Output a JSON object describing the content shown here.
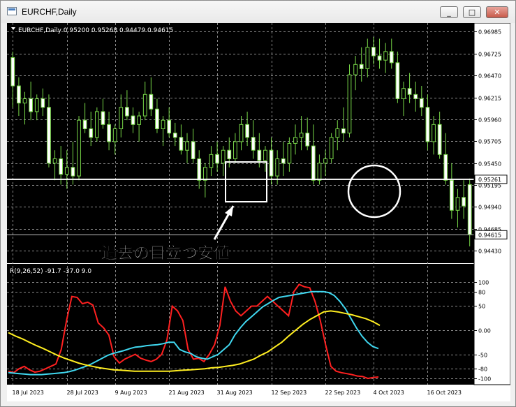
{
  "window": {
    "title": "EURCHF,Daily",
    "buttons": {
      "minimize": "_",
      "maximize": "□",
      "close": "✕"
    }
  },
  "chart_data": {
    "type": "candlestick",
    "symbol_info": "EURCHF,Daily  0.95200 0.95268 0.94479 0.94615",
    "price_axis": {
      "ylim": [
        0.943,
        0.9705
      ],
      "ticks": [
        "0.96985",
        "0.96725",
        "0.96470",
        "0.96215",
        "0.95960",
        "0.95705",
        "0.95450",
        "0.95195",
        "0.94940",
        "0.94685",
        "0.94430"
      ],
      "current_price_label": "0.94615",
      "horizontal_line_label": "0.95261"
    },
    "horizontal_line": 0.95261,
    "current_price": 0.94615,
    "date_axis": [
      "18 Jul 2023",
      "28 Jul 2023",
      "9 Aug 2023",
      "21 Aug 2023",
      "31 Aug 2023",
      "12 Sep 2023",
      "22 Sep 2023",
      "4 Oct 2023",
      "16 Oct 2023"
    ],
    "candles": [
      {
        "o": 0.9668,
        "h": 0.9675,
        "l": 0.961,
        "c": 0.9635
      },
      {
        "o": 0.9635,
        "h": 0.9645,
        "l": 0.96,
        "c": 0.9615
      },
      {
        "o": 0.9615,
        "h": 0.9628,
        "l": 0.959,
        "c": 0.962
      },
      {
        "o": 0.962,
        "h": 0.964,
        "l": 0.9595,
        "c": 0.9605
      },
      {
        "o": 0.9605,
        "h": 0.9625,
        "l": 0.9595,
        "c": 0.962
      },
      {
        "o": 0.962,
        "h": 0.9632,
        "l": 0.96,
        "c": 0.961
      },
      {
        "o": 0.961,
        "h": 0.9625,
        "l": 0.954,
        "c": 0.9545
      },
      {
        "o": 0.9545,
        "h": 0.956,
        "l": 0.9525,
        "c": 0.955
      },
      {
        "o": 0.955,
        "h": 0.9565,
        "l": 0.952,
        "c": 0.9532
      },
      {
        "o": 0.9532,
        "h": 0.956,
        "l": 0.9515,
        "c": 0.954
      },
      {
        "o": 0.954,
        "h": 0.957,
        "l": 0.952,
        "c": 0.953
      },
      {
        "o": 0.953,
        "h": 0.96,
        "l": 0.9525,
        "c": 0.9595
      },
      {
        "o": 0.9595,
        "h": 0.9615,
        "l": 0.958,
        "c": 0.9585
      },
      {
        "o": 0.9585,
        "h": 0.9605,
        "l": 0.9565,
        "c": 0.9575
      },
      {
        "o": 0.9575,
        "h": 0.961,
        "l": 0.957,
        "c": 0.9605
      },
      {
        "o": 0.9605,
        "h": 0.962,
        "l": 0.9585,
        "c": 0.959
      },
      {
        "o": 0.959,
        "h": 0.9605,
        "l": 0.956,
        "c": 0.957
      },
      {
        "o": 0.957,
        "h": 0.959,
        "l": 0.9555,
        "c": 0.9585
      },
      {
        "o": 0.9585,
        "h": 0.9625,
        "l": 0.9575,
        "c": 0.961
      },
      {
        "o": 0.961,
        "h": 0.963,
        "l": 0.9595,
        "c": 0.96
      },
      {
        "o": 0.96,
        "h": 0.961,
        "l": 0.958,
        "c": 0.959
      },
      {
        "o": 0.959,
        "h": 0.9605,
        "l": 0.957,
        "c": 0.96
      },
      {
        "o": 0.96,
        "h": 0.964,
        "l": 0.9595,
        "c": 0.9625
      },
      {
        "o": 0.9625,
        "h": 0.9645,
        "l": 0.96,
        "c": 0.9608
      },
      {
        "o": 0.9608,
        "h": 0.962,
        "l": 0.958,
        "c": 0.9585
      },
      {
        "o": 0.9585,
        "h": 0.96,
        "l": 0.9565,
        "c": 0.9595
      },
      {
        "o": 0.9595,
        "h": 0.961,
        "l": 0.9575,
        "c": 0.958
      },
      {
        "o": 0.958,
        "h": 0.9592,
        "l": 0.9565,
        "c": 0.9575
      },
      {
        "o": 0.9575,
        "h": 0.959,
        "l": 0.9555,
        "c": 0.956
      },
      {
        "o": 0.956,
        "h": 0.958,
        "l": 0.9545,
        "c": 0.957
      },
      {
        "o": 0.957,
        "h": 0.9585,
        "l": 0.9545,
        "c": 0.955
      },
      {
        "o": 0.955,
        "h": 0.956,
        "l": 0.9515,
        "c": 0.9525
      },
      {
        "o": 0.9525,
        "h": 0.9545,
        "l": 0.9505,
        "c": 0.954
      },
      {
        "o": 0.954,
        "h": 0.9565,
        "l": 0.953,
        "c": 0.9555
      },
      {
        "o": 0.9555,
        "h": 0.957,
        "l": 0.9535,
        "c": 0.9545
      },
      {
        "o": 0.9545,
        "h": 0.9565,
        "l": 0.953,
        "c": 0.956
      },
      {
        "o": 0.956,
        "h": 0.9575,
        "l": 0.954,
        "c": 0.955
      },
      {
        "o": 0.955,
        "h": 0.958,
        "l": 0.9545,
        "c": 0.957
      },
      {
        "o": 0.957,
        "h": 0.96,
        "l": 0.956,
        "c": 0.959
      },
      {
        "o": 0.959,
        "h": 0.9605,
        "l": 0.9565,
        "c": 0.9575
      },
      {
        "o": 0.9575,
        "h": 0.9595,
        "l": 0.955,
        "c": 0.956
      },
      {
        "o": 0.956,
        "h": 0.958,
        "l": 0.954,
        "c": 0.9548
      },
      {
        "o": 0.9548,
        "h": 0.9565,
        "l": 0.9535,
        "c": 0.956
      },
      {
        "o": 0.956,
        "h": 0.9575,
        "l": 0.952,
        "c": 0.953
      },
      {
        "o": 0.953,
        "h": 0.956,
        "l": 0.952,
        "c": 0.955
      },
      {
        "o": 0.955,
        "h": 0.957,
        "l": 0.953,
        "c": 0.9545
      },
      {
        "o": 0.9545,
        "h": 0.9575,
        "l": 0.9535,
        "c": 0.9568
      },
      {
        "o": 0.9568,
        "h": 0.959,
        "l": 0.9555,
        "c": 0.9575
      },
      {
        "o": 0.9575,
        "h": 0.96,
        "l": 0.956,
        "c": 0.958
      },
      {
        "o": 0.958,
        "h": 0.9598,
        "l": 0.956,
        "c": 0.9565
      },
      {
        "o": 0.9565,
        "h": 0.959,
        "l": 0.952,
        "c": 0.9525
      },
      {
        "o": 0.9525,
        "h": 0.9555,
        "l": 0.952,
        "c": 0.9545
      },
      {
        "o": 0.9545,
        "h": 0.956,
        "l": 0.953,
        "c": 0.955
      },
      {
        "o": 0.955,
        "h": 0.958,
        "l": 0.9545,
        "c": 0.9575
      },
      {
        "o": 0.9575,
        "h": 0.9595,
        "l": 0.956,
        "c": 0.9585
      },
      {
        "o": 0.9585,
        "h": 0.961,
        "l": 0.957,
        "c": 0.958
      },
      {
        "o": 0.958,
        "h": 0.966,
        "l": 0.9575,
        "c": 0.9648
      },
      {
        "o": 0.9648,
        "h": 0.967,
        "l": 0.963,
        "c": 0.966
      },
      {
        "o": 0.966,
        "h": 0.968,
        "l": 0.964,
        "c": 0.9655
      },
      {
        "o": 0.9655,
        "h": 0.969,
        "l": 0.9645,
        "c": 0.968
      },
      {
        "o": 0.968,
        "h": 0.9692,
        "l": 0.966,
        "c": 0.967
      },
      {
        "o": 0.967,
        "h": 0.969,
        "l": 0.9655,
        "c": 0.9665
      },
      {
        "o": 0.9665,
        "h": 0.9685,
        "l": 0.965,
        "c": 0.9675
      },
      {
        "o": 0.9675,
        "h": 0.969,
        "l": 0.9655,
        "c": 0.9662
      },
      {
        "o": 0.9662,
        "h": 0.9675,
        "l": 0.9615,
        "c": 0.962
      },
      {
        "o": 0.962,
        "h": 0.964,
        "l": 0.96,
        "c": 0.9632
      },
      {
        "o": 0.9632,
        "h": 0.965,
        "l": 0.9615,
        "c": 0.9625
      },
      {
        "o": 0.9625,
        "h": 0.964,
        "l": 0.9605,
        "c": 0.962
      },
      {
        "o": 0.962,
        "h": 0.9635,
        "l": 0.96,
        "c": 0.961
      },
      {
        "o": 0.961,
        "h": 0.9625,
        "l": 0.956,
        "c": 0.957
      },
      {
        "o": 0.957,
        "h": 0.96,
        "l": 0.9555,
        "c": 0.959
      },
      {
        "o": 0.959,
        "h": 0.9605,
        "l": 0.955,
        "c": 0.9555
      },
      {
        "o": 0.9555,
        "h": 0.958,
        "l": 0.952,
        "c": 0.9525
      },
      {
        "o": 0.9525,
        "h": 0.9545,
        "l": 0.948,
        "c": 0.949
      },
      {
        "o": 0.949,
        "h": 0.9515,
        "l": 0.947,
        "c": 0.9505
      },
      {
        "o": 0.9505,
        "h": 0.9525,
        "l": 0.948,
        "c": 0.9495
      },
      {
        "o": 0.952,
        "h": 0.9527,
        "l": 0.9448,
        "c": 0.9462
      }
    ],
    "annotation_text": "過去の目立つ安値",
    "indicator": {
      "label": "R(9,26,52) -91.7 -37.0 9.0",
      "ylim": [
        -110,
        110
      ],
      "ticks": [
        "100",
        "80",
        "50",
        "0.00",
        "-50",
        "-80",
        "-100"
      ],
      "series": [
        {
          "color": "#ff2020",
          "values": [
            -85,
            -88,
            -80,
            -75,
            -82,
            -87,
            -85,
            -80,
            -75,
            -70,
            -40,
            20,
            70,
            68,
            55,
            58,
            52,
            15,
            5,
            -10,
            -55,
            -68,
            -60,
            -55,
            -50,
            -58,
            -62,
            -65,
            -60,
            -50,
            -20,
            50,
            40,
            20,
            -40,
            -60,
            -58,
            -65,
            -50,
            -30,
            10,
            90,
            60,
            40,
            30,
            40,
            50,
            50,
            60,
            70,
            60,
            50,
            40,
            30,
            80,
            95,
            90,
            88,
            60,
            20,
            -30,
            -75,
            -85,
            -88,
            -90,
            -92,
            -95,
            -96,
            -100,
            -98,
            -97
          ]
        },
        {
          "color": "#40d8f0",
          "values": [
            -88,
            -89,
            -90,
            -91,
            -92,
            -92,
            -92,
            -91,
            -90,
            -89,
            -88,
            -86,
            -83,
            -79,
            -75,
            -70,
            -64,
            -58,
            -52,
            -48,
            -45,
            -42,
            -38,
            -35,
            -34,
            -32,
            -31,
            -30,
            -28,
            -25,
            -25,
            -40,
            -45,
            -48,
            -55,
            -58,
            -60,
            -55,
            -50,
            -40,
            -30,
            -10,
            5,
            18,
            28,
            38,
            48,
            55,
            62,
            68,
            70,
            72,
            74,
            76,
            78,
            80,
            80,
            80,
            78,
            72,
            60,
            45,
            25,
            5,
            -12,
            -25,
            -34,
            -38
          ]
        },
        {
          "color": "#ffee20",
          "values": [
            -5,
            -12,
            -18,
            -25,
            -32,
            -38,
            -45,
            -52,
            -58,
            -63,
            -68,
            -72,
            -75,
            -78,
            -80,
            -82,
            -83,
            -84,
            -85,
            -85,
            -85,
            -85,
            -85,
            -85,
            -84,
            -83,
            -82,
            -81,
            -80,
            -78,
            -77,
            -75,
            -73,
            -70,
            -65,
            -60,
            -52,
            -45,
            -35,
            -25,
            -12,
            0,
            12,
            22,
            30,
            38,
            40,
            38,
            35,
            32,
            28,
            24,
            18,
            10
          ]
        }
      ]
    }
  }
}
